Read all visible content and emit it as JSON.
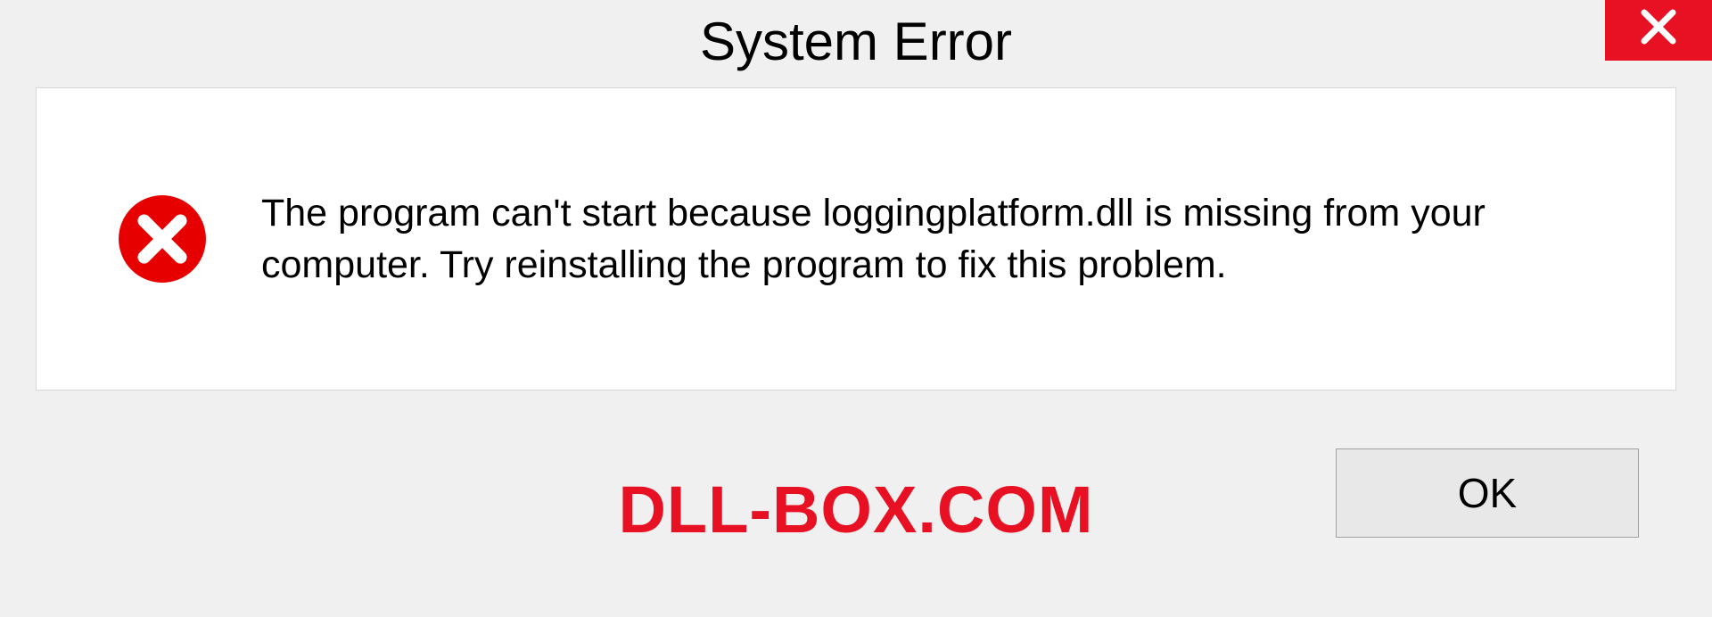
{
  "dialog": {
    "title": "System Error",
    "message": "The program can't start because loggingplatform.dll is missing from your computer. Try reinstalling the program to fix this problem.",
    "ok_label": "OK"
  },
  "watermark": "DLL-BOX.COM",
  "colors": {
    "error_red": "#e81123",
    "close_red": "#e81123"
  }
}
